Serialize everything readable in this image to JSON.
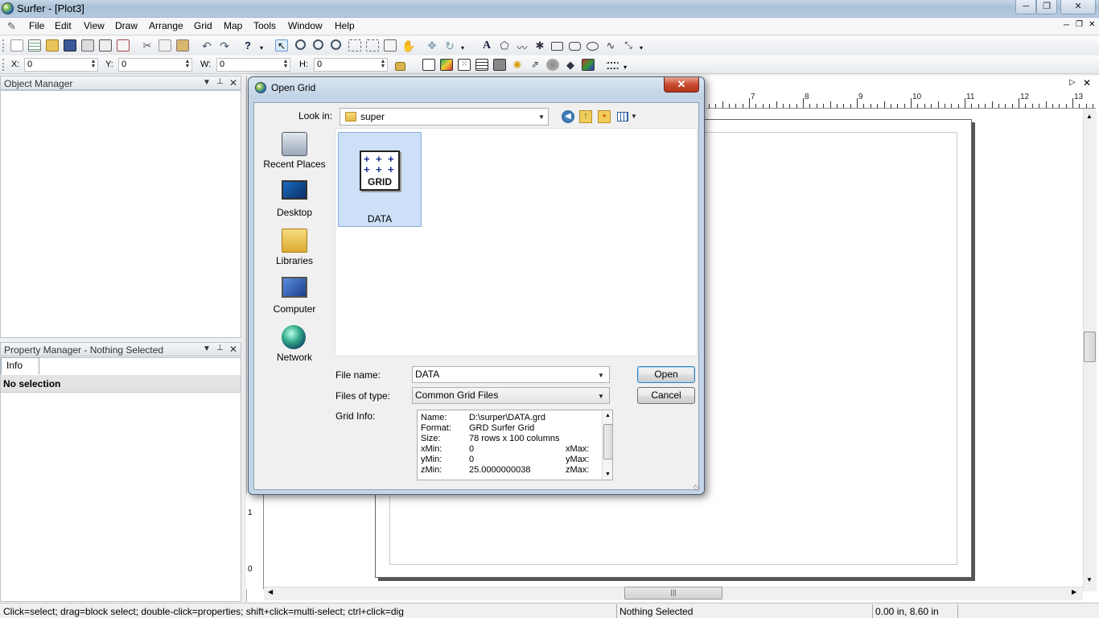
{
  "window": {
    "title": "Surfer - [Plot3]"
  },
  "menubar": [
    "File",
    "Edit",
    "View",
    "Draw",
    "Arrange",
    "Grid",
    "Map",
    "Tools",
    "Window",
    "Help"
  ],
  "coords": {
    "x_label": "X:",
    "x_val": "0",
    "y_label": "Y:",
    "y_val": "0",
    "w_label": "W:",
    "w_val": "0",
    "h_label": "H:",
    "h_val": "0"
  },
  "object_manager": {
    "title": "Object Manager"
  },
  "property_manager": {
    "title": "Property Manager - Nothing Selected",
    "tab": "Info",
    "row": "No selection"
  },
  "ruler": {
    "top_numbers": [
      "7",
      "8",
      "9",
      "10",
      "11",
      "12",
      "13"
    ],
    "left_numbers": [
      "1",
      "0"
    ]
  },
  "status": {
    "hint": "Click=select; drag=block select; double-click=properties; shift+click=multi-select; ctrl+click=dig",
    "selection": "Nothing Selected",
    "position": "0.00 in, 8.60 in"
  },
  "dialog": {
    "title": "Open Grid",
    "close_glyph": "✕",
    "look_in_label": "Look in:",
    "look_in_value": "super",
    "places": [
      "Recent Places",
      "Desktop",
      "Libraries",
      "Computer",
      "Network"
    ],
    "file_item": "DATA",
    "file_icon_text": "GRID",
    "file_name_label": "File name:",
    "file_name_value": "DATA",
    "files_of_type_label": "Files of type:",
    "files_of_type_value": "Common Grid Files",
    "open_button": "Open",
    "cancel_button": "Cancel",
    "grid_info_label": "Grid Info:",
    "grid_info": {
      "name_label": "Name:",
      "name": "D:\\surper\\DATA.grd",
      "format_label": "Format:",
      "format": "GRD Surfer Grid",
      "size_label": "Size:",
      "size": "78 rows x 100 columns",
      "xmin_label": "xMin:",
      "xmin": "0",
      "xmax_label": "xMax:",
      "ymin_label": "yMin:",
      "ymin": "0",
      "ymax_label": "yMax:",
      "zmin_label": "zMin:",
      "zmin": "25.0000000038",
      "zmax_label": "zMax:"
    }
  },
  "colors": {
    "selection": "#cce0f7",
    "close_red": "#c84a30",
    "dialog_frame": "#c4d5e7"
  }
}
